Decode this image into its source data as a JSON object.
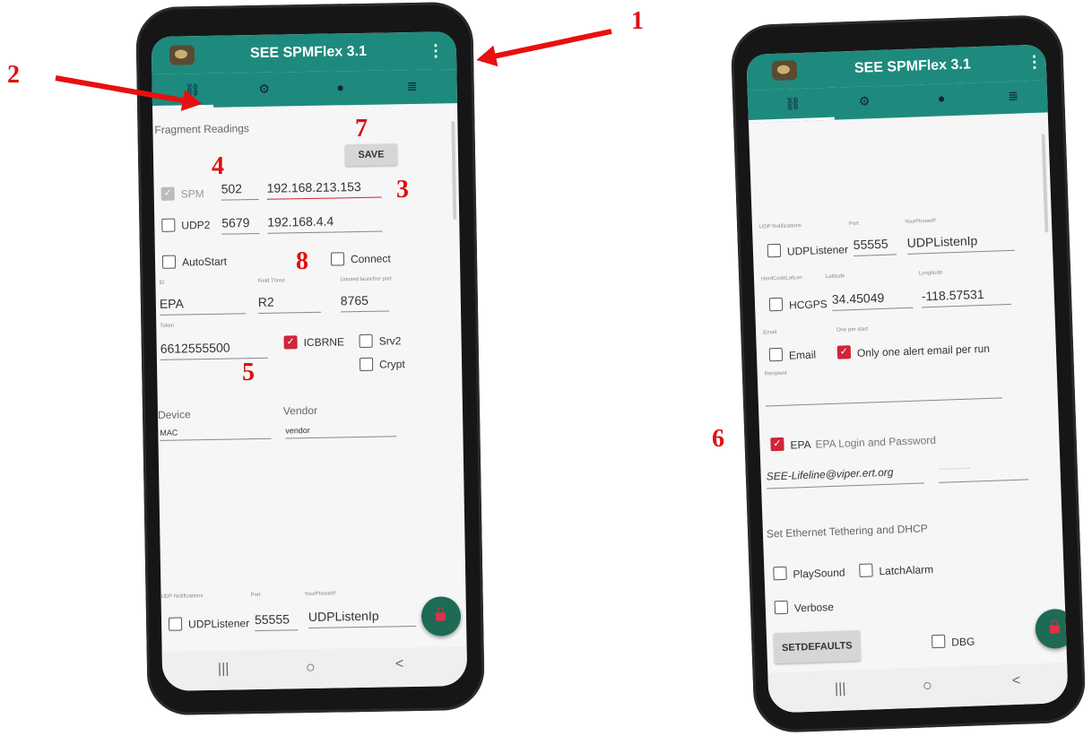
{
  "app_title": "SEE SPMFlex 3.1",
  "colors": {
    "appbar": "#1e8a7d",
    "accent_checkbox": "#d0253b",
    "fab": "#1e6a55",
    "annotation": "#e01010"
  },
  "tab_icons": [
    "link-icon",
    "gear-icon",
    "info-icon",
    "list-icon"
  ],
  "annotations": {
    "n1": "1",
    "n2": "2",
    "n3": "3",
    "n4": "4",
    "n5": "5",
    "n6": "6",
    "n7": "7",
    "n8": "8"
  },
  "left": {
    "fragment_readings": "Fragment Readings",
    "save_label": "SAVE",
    "spm_label": "SPM",
    "spm_port": "502",
    "spm_ip": "192.168.213.153",
    "udp2_label": "UDP2",
    "udp2_port": "5679",
    "udp2_ip": "192.168.4.4",
    "autostart_label": "AutoStart",
    "connect_label": "Connect",
    "id_hint": "ID",
    "id_value": "EPA",
    "field_three_hint": "Field Three",
    "field_three_value": "R2",
    "unused_port_hint": "Unused launcher port",
    "unused_port_value": "8765",
    "token_hint": "Token",
    "token_value": "6612555500",
    "icbrne_label": "ICBRNE",
    "srv2_label": "Srv2",
    "crypt_label": "Crypt",
    "device_hint": "Device",
    "device_value": "MAC",
    "vendor_hint": "Vendor",
    "vendor_value": "vendor",
    "udp_notifications_hint": "UDP Notifications",
    "port_hint": "Port",
    "your_phone_ip_hint": "YourPhoneIP",
    "udplistener_label": "UDPListener",
    "udplistener_port": "55555",
    "udplisten_ip": "UDPListenIp",
    "nav_recents": "|||",
    "nav_home": "○",
    "nav_back": "<"
  },
  "right": {
    "udp_notifications_hint": "UDP Notifications",
    "port_hint": "Port",
    "your_phone_ip_hint": "YourPhoneIP",
    "udplistener_label": "UDPListener",
    "udplistener_port": "55555",
    "udplisten_ip": "UDPListenIp",
    "hardcode_hint": "HardCodeLatLon",
    "latitude_hint": "Latitude",
    "longitude_hint": "Longitude",
    "hcgps_label": "HCGPS",
    "latitude_value": "34.45049",
    "longitude_value": "-118.57531",
    "email_hint": "Email",
    "one_per_start_hint": "One per start",
    "email_label": "Email",
    "one_alert_label": "Only one alert email per run",
    "recipient_hint": "Recipient",
    "epa_label": "EPA",
    "epa_desc": "EPA Login and Password",
    "epa_email": "SEE-Lifeline@viper.ert.org",
    "epa_password": "············",
    "ethernet_label": "Set Ethernet Tethering and DHCP",
    "playsound_label": "PlaySound",
    "latchalarm_label": "LatchAlarm",
    "verbose_label": "Verbose",
    "setdefaults_label": "SETDEFAULTS",
    "dbg_label": "DBG",
    "nav_recents": "|||",
    "nav_home": "○",
    "nav_back": "<"
  }
}
